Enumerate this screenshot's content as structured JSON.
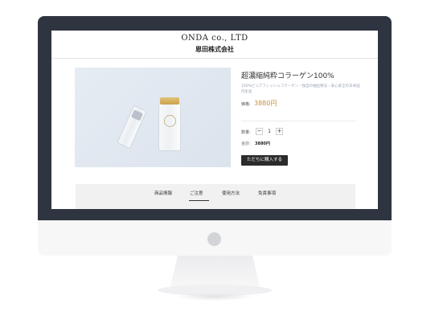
{
  "header": {
    "brand_en": "ONDA co., LTD",
    "brand_jp": "恩田株式会社"
  },
  "product": {
    "title": "超濃縮純粋コラーゲン100%",
    "description": "100%ピュアフィッシュコラーゲン・独自の抽出製法・安心安全の日本国内生産",
    "price_label": "価格:",
    "price": "3880円",
    "quantity_label": "数量:",
    "quantity_minus": "−",
    "quantity_value": "1",
    "quantity_plus": "+",
    "total_label": "合計:",
    "total_value": "3880円",
    "buy_button": "ただちに購入する"
  },
  "tabs": [
    {
      "label": "商品情報"
    },
    {
      "label": "ご注意"
    },
    {
      "label": "使用方法"
    },
    {
      "label": "免責事項"
    }
  ],
  "colors": {
    "monitor_bezel": "#2f3540",
    "price_accent": "#c8903e",
    "button_bg": "#2b2b2b"
  }
}
